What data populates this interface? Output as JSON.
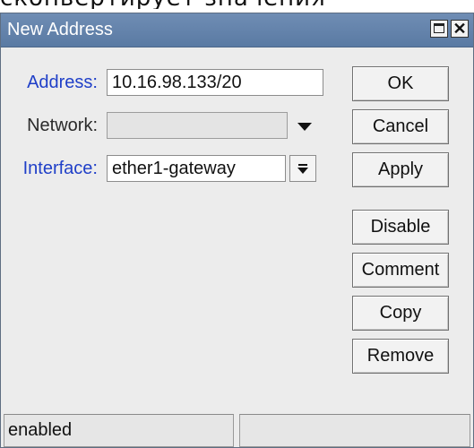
{
  "background_caption": "сконвертирует значения",
  "window": {
    "title": "New Address",
    "close_glyph": "✕"
  },
  "form": {
    "address": {
      "label": "Address:",
      "value": "10.16.98.133/20"
    },
    "network": {
      "label": "Network:",
      "value": ""
    },
    "interface": {
      "label": "Interface:",
      "value": "ether1-gateway"
    }
  },
  "buttons": {
    "ok": "OK",
    "cancel": "Cancel",
    "apply": "Apply",
    "disable": "Disable",
    "comment": "Comment",
    "copy": "Copy",
    "remove": "Remove"
  },
  "status": {
    "left": "enabled",
    "right": ""
  },
  "colors": {
    "titlebar": "#5a7aa3",
    "label_accent": "#1f3fc8",
    "window_bg": "#ececec"
  }
}
